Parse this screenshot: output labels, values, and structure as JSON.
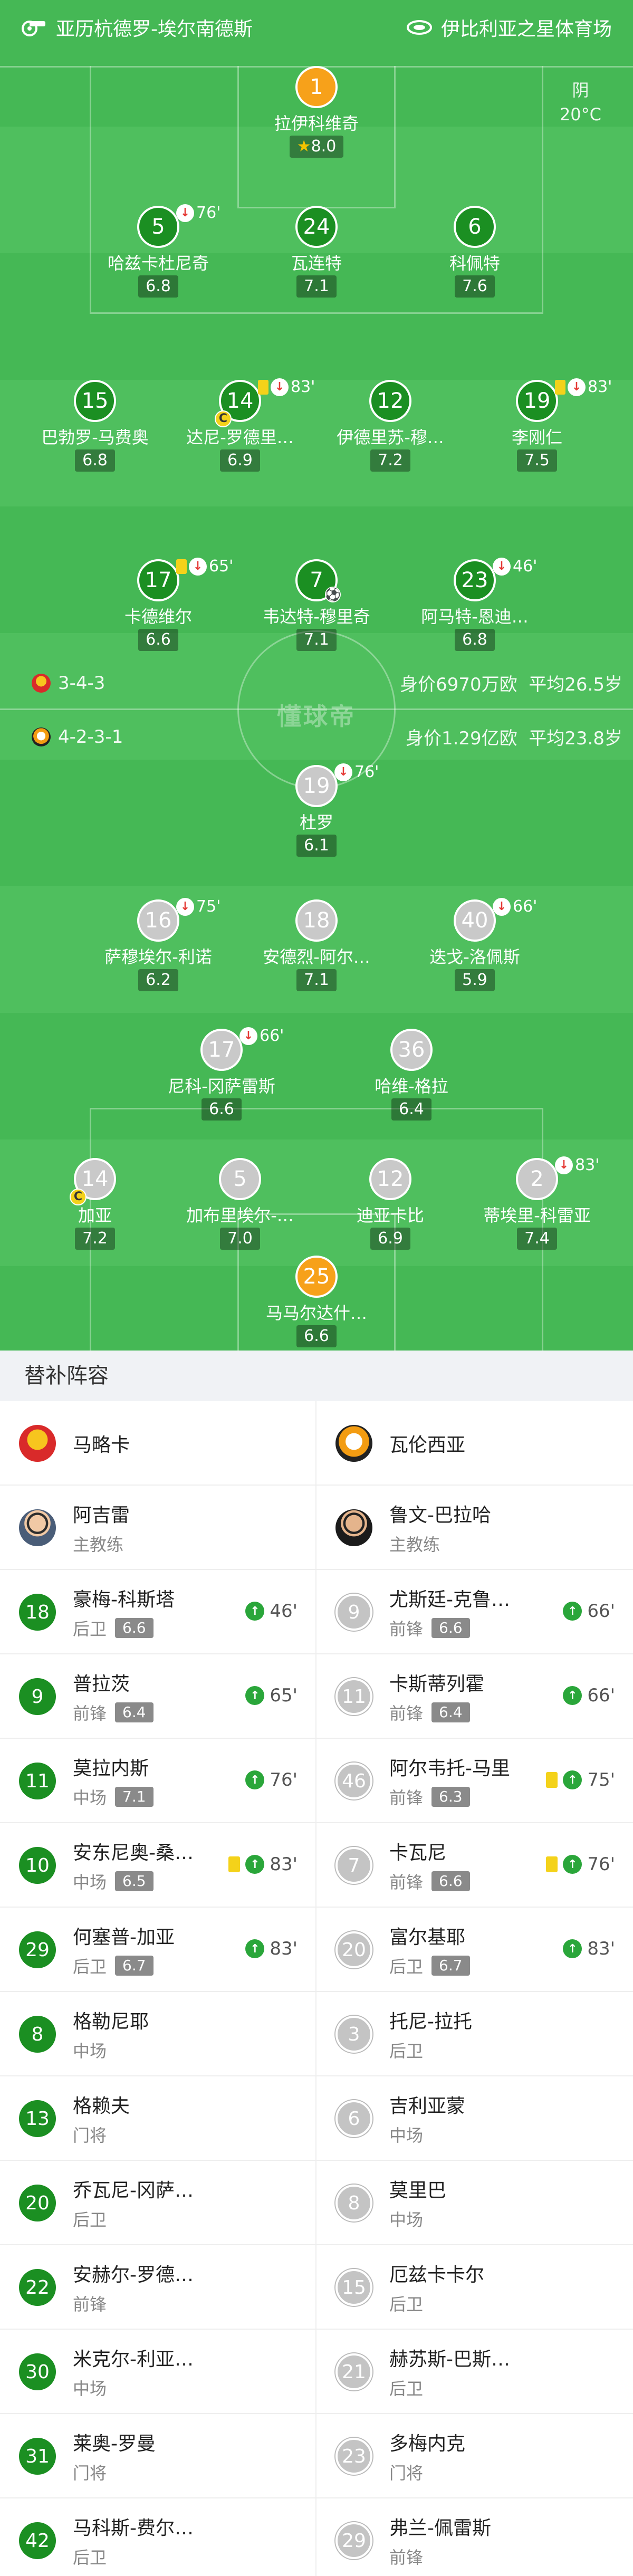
{
  "header": {
    "home_team": "亚历杭德罗-埃尔南德斯",
    "away_team": "伊比利亚之星体育场",
    "weather": "阴",
    "temperature": "20°C"
  },
  "formations": {
    "home": {
      "formation": "3-4-3",
      "value": "身价6970万欧",
      "avg_age": "平均26.5岁"
    },
    "away": {
      "formation": "4-2-3-1",
      "value": "身价1.29亿欧",
      "avg_age": "平均23.8岁"
    }
  },
  "watermark": "懂球帝",
  "home_players": [
    {
      "num": "1",
      "name": "拉伊科维奇",
      "rating": "8.0"
    },
    {
      "num": "5",
      "name": "哈兹卡杜尼奇",
      "rating": "6.8",
      "sub_min": "76'"
    },
    {
      "num": "24",
      "name": "瓦连特",
      "rating": "7.1"
    },
    {
      "num": "6",
      "name": "科佩特",
      "rating": "7.6"
    },
    {
      "num": "15",
      "name": "巴勃罗-马费奥",
      "rating": "6.8"
    },
    {
      "num": "14",
      "name": "达尼-罗德里…",
      "rating": "6.9",
      "sub_min": "83'"
    },
    {
      "num": "12",
      "name": "伊德里苏-穆…",
      "rating": "7.2"
    },
    {
      "num": "19",
      "name": "李刚仁",
      "rating": "7.5",
      "sub_min": "83'"
    },
    {
      "num": "17",
      "name": "卡德维尔",
      "rating": "6.6",
      "sub_min": "65'"
    },
    {
      "num": "7",
      "name": "韦达特-穆里奇",
      "rating": "7.1"
    },
    {
      "num": "23",
      "name": "阿马特-恩迪…",
      "rating": "6.8",
      "sub_min": "46'"
    }
  ],
  "away_players": [
    {
      "num": "19",
      "name": "杜罗",
      "rating": "6.1",
      "sub_min": "76'"
    },
    {
      "num": "16",
      "name": "萨穆埃尔-利诺",
      "rating": "6.2",
      "sub_min": "75'"
    },
    {
      "num": "18",
      "name": "安德烈-阿尔…",
      "rating": "7.1"
    },
    {
      "num": "40",
      "name": "迭戈-洛佩斯",
      "rating": "5.9",
      "sub_min": "66'"
    },
    {
      "num": "17",
      "name": "尼科-冈萨雷斯",
      "rating": "6.6",
      "sub_min": "66'"
    },
    {
      "num": "36",
      "name": "哈维-格拉",
      "rating": "6.4"
    },
    {
      "num": "14",
      "name": "加亚",
      "rating": "7.2"
    },
    {
      "num": "5",
      "name": "加布里埃尔-…",
      "rating": "7.0"
    },
    {
      "num": "12",
      "name": "迪亚卡比",
      "rating": "6.9"
    },
    {
      "num": "2",
      "name": "蒂埃里-科雷亚",
      "rating": "7.4",
      "sub_min": "83'"
    },
    {
      "num": "25",
      "name": "马马尔达什…",
      "rating": "6.6"
    }
  ],
  "bench": {
    "title": "替补阵容",
    "home_team_name": "马略卡",
    "away_team_name": "瓦伦西亚",
    "home_coach": {
      "name": "阿吉雷",
      "role": "主教练"
    },
    "away_coach": {
      "name": "鲁文-巴拉哈",
      "role": "主教练"
    },
    "home_subs": [
      {
        "num": "18",
        "name": "豪梅-科斯塔",
        "pos": "后卫",
        "rating": "6.6",
        "min": "46'"
      },
      {
        "num": "9",
        "name": "普拉茨",
        "pos": "前锋",
        "rating": "6.4",
        "min": "65'"
      },
      {
        "num": "11",
        "name": "莫拉内斯",
        "pos": "中场",
        "rating": "7.1",
        "min": "76'"
      },
      {
        "num": "10",
        "name": "安东尼奥-桑…",
        "pos": "中场",
        "rating": "6.5",
        "min": "83'",
        "card": true
      },
      {
        "num": "29",
        "name": "何塞普-加亚",
        "pos": "后卫",
        "rating": "6.7",
        "min": "83'"
      },
      {
        "num": "8",
        "name": "格勒尼耶",
        "pos": "中场"
      },
      {
        "num": "13",
        "name": "格赖夫",
        "pos": "门将"
      },
      {
        "num": "20",
        "name": "乔瓦尼-冈萨…",
        "pos": "后卫"
      },
      {
        "num": "22",
        "name": "安赫尔-罗德…",
        "pos": "前锋"
      },
      {
        "num": "30",
        "name": "米克尔-利亚…",
        "pos": "中场"
      },
      {
        "num": "31",
        "name": "莱奥-罗曼",
        "pos": "门将"
      },
      {
        "num": "42",
        "name": "马科斯-费尔…",
        "pos": "后卫"
      }
    ],
    "away_subs": [
      {
        "num": "9",
        "name": "尤斯廷-克鲁…",
        "pos": "前锋",
        "rating": "6.6",
        "min": "66'"
      },
      {
        "num": "11",
        "name": "卡斯蒂列霍",
        "pos": "前锋",
        "rating": "6.4",
        "min": "66'"
      },
      {
        "num": "46",
        "name": "阿尔韦托-马里",
        "pos": "前锋",
        "rating": "6.3",
        "min": "75'",
        "card": true
      },
      {
        "num": "7",
        "name": "卡瓦尼",
        "pos": "前锋",
        "rating": "6.6",
        "min": "76'",
        "card": true
      },
      {
        "num": "20",
        "name": "富尔基耶",
        "pos": "后卫",
        "rating": "6.7",
        "min": "83'"
      },
      {
        "num": "3",
        "name": "托尼-拉托",
        "pos": "后卫"
      },
      {
        "num": "6",
        "name": "吉利亚蒙",
        "pos": "中场"
      },
      {
        "num": "8",
        "name": "莫里巴",
        "pos": "中场"
      },
      {
        "num": "15",
        "name": "厄兹卡卡尔",
        "pos": "后卫"
      },
      {
        "num": "21",
        "name": "赫苏斯-巴斯…",
        "pos": "后卫"
      },
      {
        "num": "23",
        "name": "多梅内克",
        "pos": "门将"
      },
      {
        "num": "29",
        "name": "弗兰-佩雷斯",
        "pos": "前锋"
      }
    ]
  }
}
